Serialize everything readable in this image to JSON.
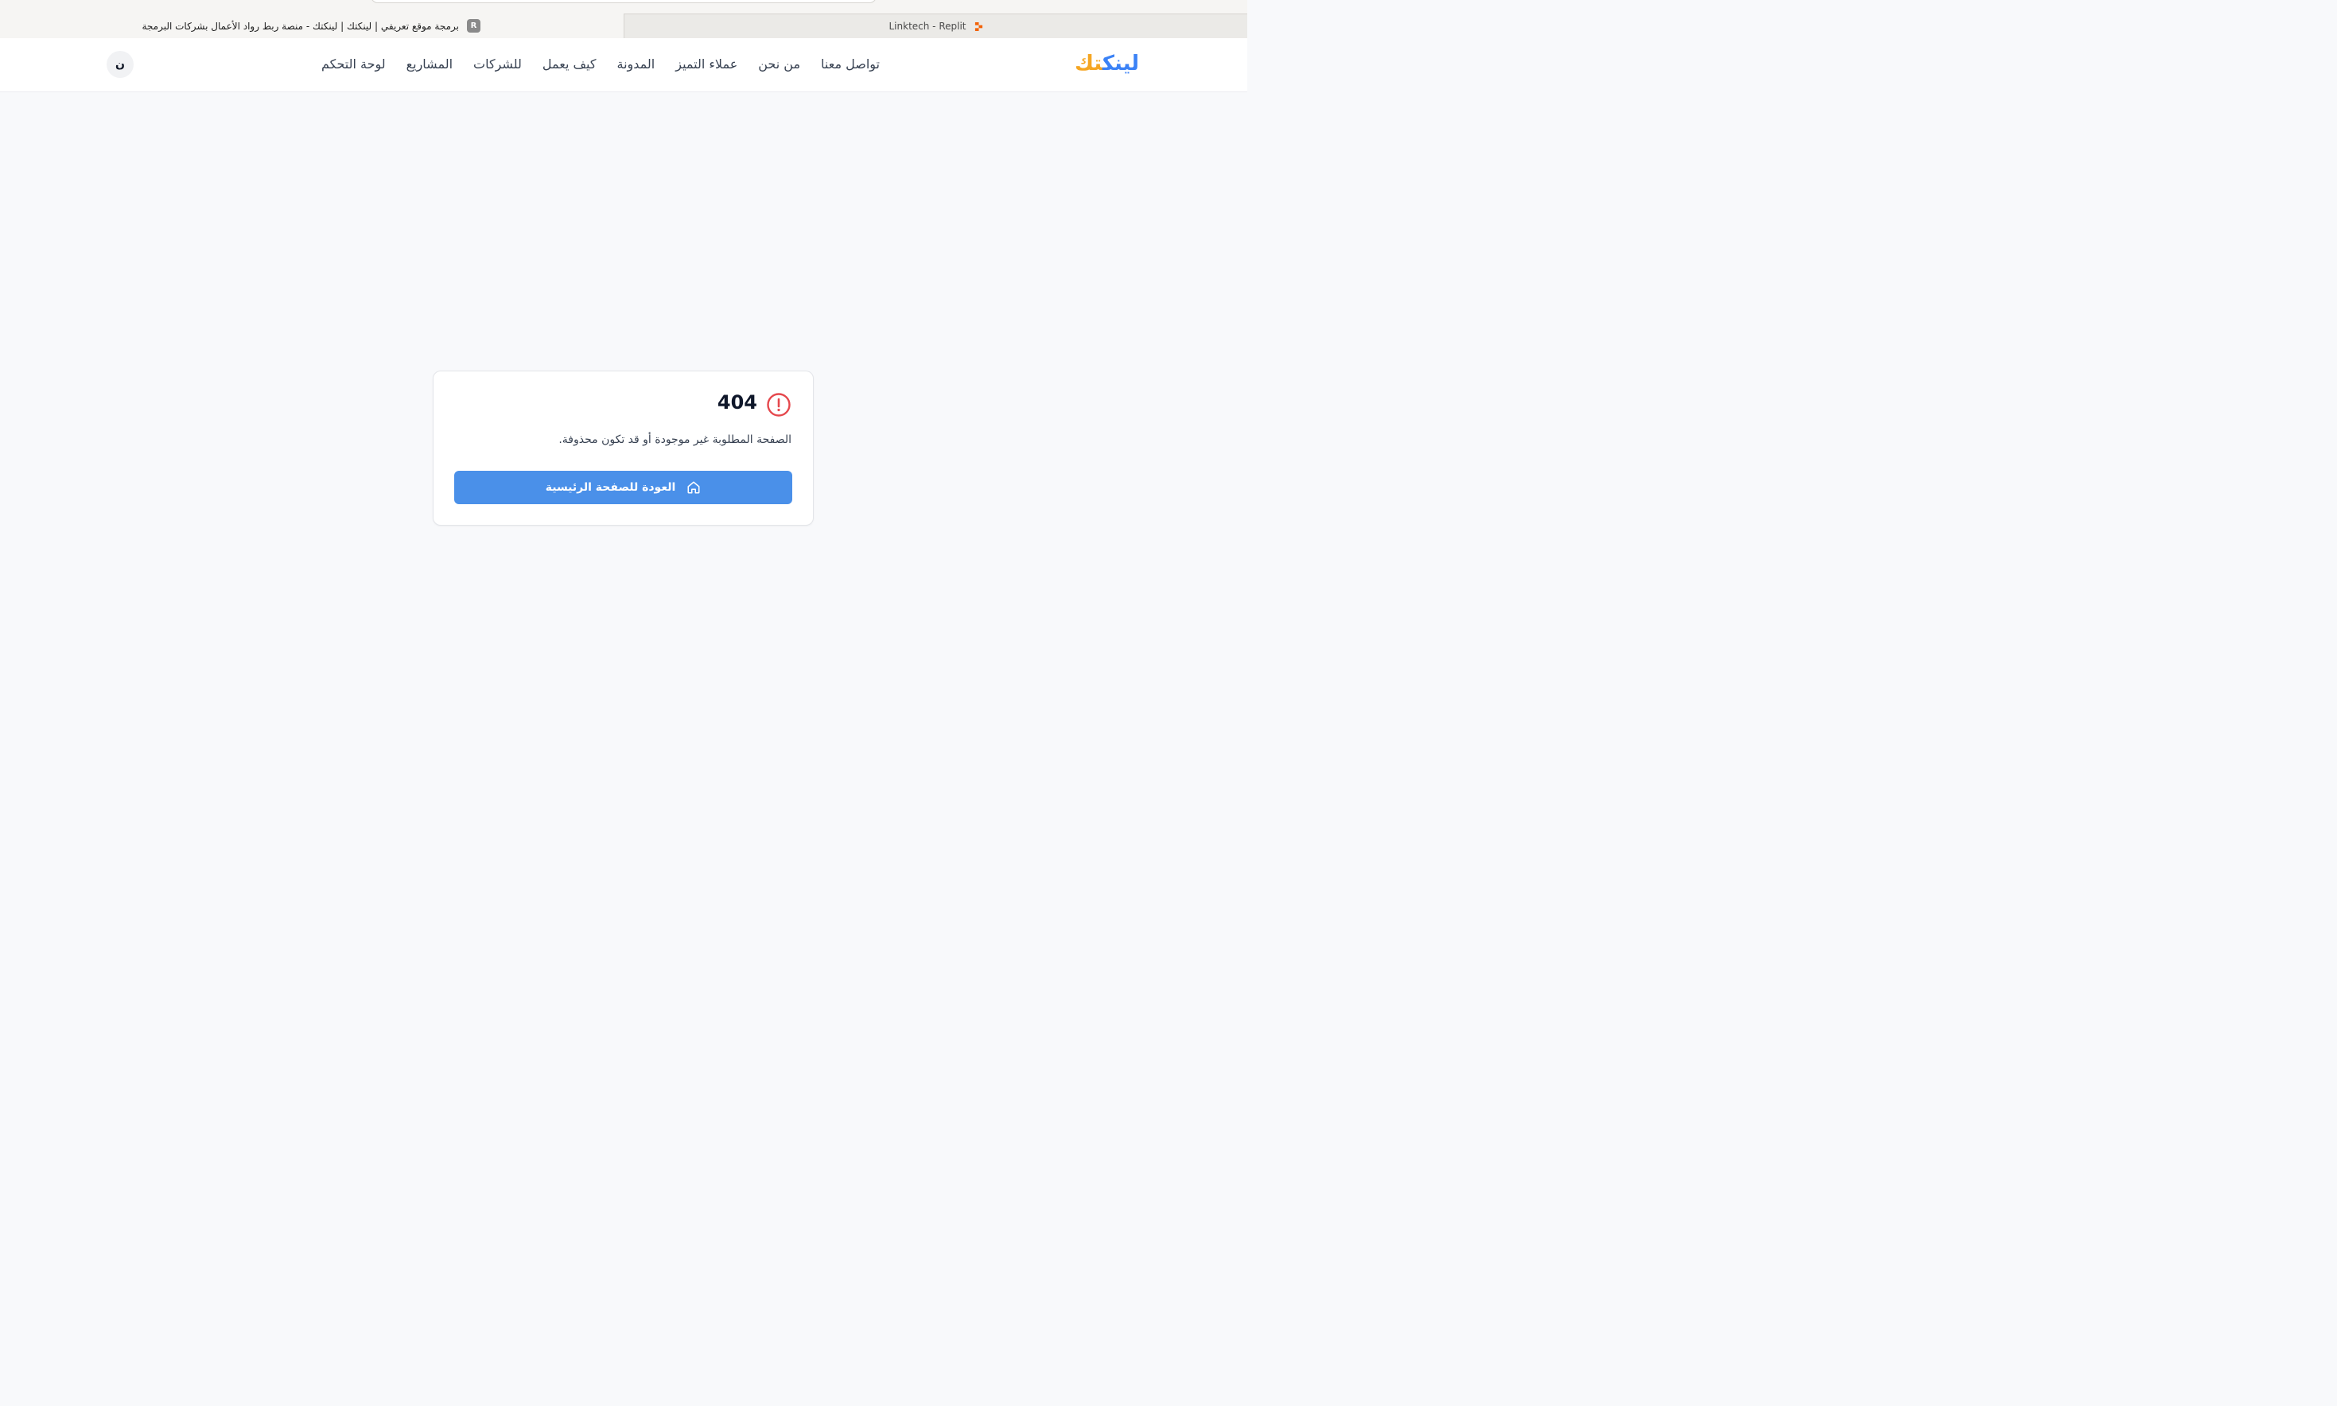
{
  "browser": {
    "active_tab_title": "برمجة موقع تعريفي | لينكتك | لينكتك - منصة ربط رواد الأعمال بشركات البرمجة",
    "active_tab_badge": "R",
    "other_tab_title": "Linktech - Replit",
    "other_tab_icon": "replit-icon"
  },
  "header": {
    "logo_part1": "لينك",
    "logo_part2": "تك",
    "nav": [
      {
        "label": "لوحة التحكم"
      },
      {
        "label": "المشاريع"
      },
      {
        "label": "للشركات"
      },
      {
        "label": "كيف يعمل"
      },
      {
        "label": "المدونة"
      },
      {
        "label": "عملاء التميز"
      },
      {
        "label": "من نحن"
      },
      {
        "label": "تواصل معنا"
      }
    ],
    "avatar_initial": "ن"
  },
  "error_card": {
    "code": "404",
    "icon": "alert-circle-icon",
    "message": "الصفحة المطلوبة غير موجودة أو قد تكون محذوفة.",
    "button_label": "العودة للصفحة الرئيسية",
    "button_icon": "home-icon"
  },
  "colors": {
    "accent": "#4a90e9",
    "logo_blue": "#3b82f6",
    "logo_orange": "#f5a623",
    "alert_red": "#e5484d",
    "page_bg": "#f8f9fb"
  }
}
